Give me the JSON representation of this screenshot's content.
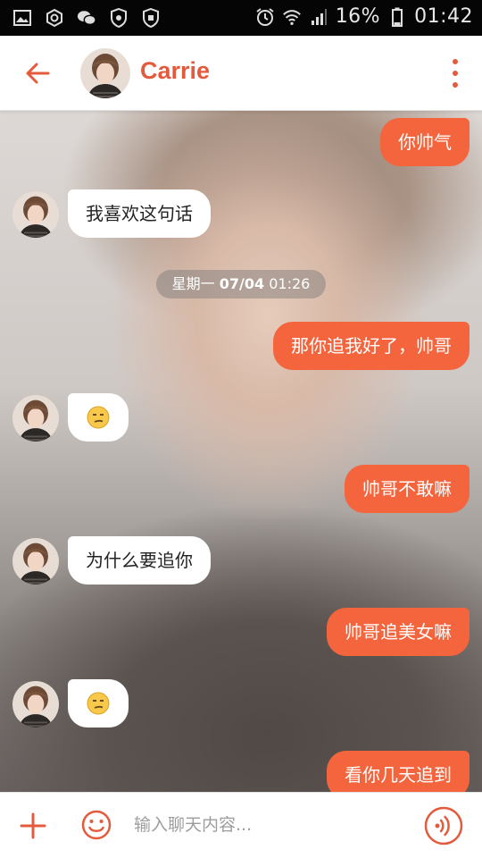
{
  "status_bar": {
    "battery": "16%",
    "time": "01:42",
    "left_icons": [
      "image-icon",
      "camera-icon",
      "wechat-icon",
      "shield-icon",
      "shield-icon"
    ],
    "right_icons": [
      "alarm-icon",
      "wifi-icon",
      "signal-icon",
      "battery-icon"
    ]
  },
  "header": {
    "contact_name": "Carrie",
    "back_icon": "arrow-left-icon",
    "menu_icon": "more-vertical-icon"
  },
  "chat": {
    "messages": [
      {
        "direction": "out",
        "text": "你帅气"
      },
      {
        "direction": "in",
        "text": "我喜欢这句话"
      },
      {
        "direction": "out",
        "text": "那你追我好了，帅哥"
      },
      {
        "direction": "in",
        "emoji": "smirk-emoji"
      },
      {
        "direction": "out",
        "text": "帅哥不敢嘛"
      },
      {
        "direction": "in",
        "text": "为什么要追你"
      },
      {
        "direction": "out",
        "text": "帅哥追美女嘛"
      },
      {
        "direction": "in",
        "emoji": "smirk-emoji"
      },
      {
        "direction": "out",
        "text": "看你几天追到"
      }
    ],
    "timestamp": {
      "weekday": "星期一",
      "date": "07/04",
      "time": "01:26"
    }
  },
  "input_bar": {
    "placeholder": "输入聊天内容...",
    "plus_icon": "plus-icon",
    "emoji_icon": "smiley-icon",
    "voice_icon": "voice-icon"
  },
  "colors": {
    "accent": "#e35b3c",
    "outgoing_bubble": "#f4643d",
    "incoming_bubble": "#ffffff",
    "statusbar": "#050505"
  }
}
